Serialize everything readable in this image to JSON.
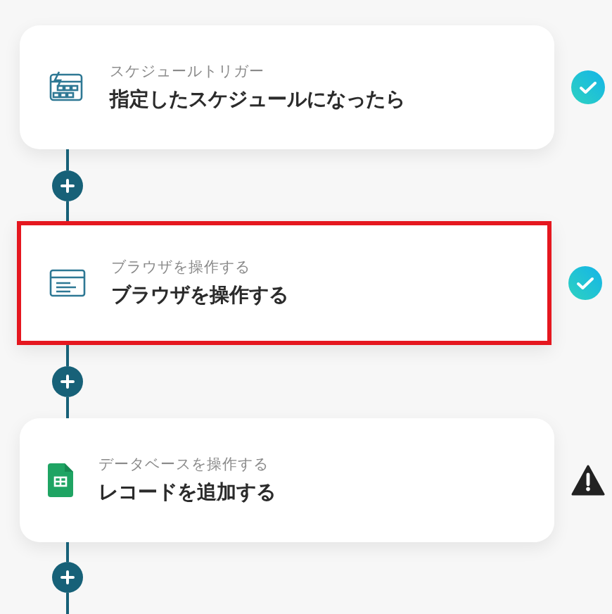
{
  "steps": [
    {
      "kind": "calendar",
      "category": "スケジュールトリガー",
      "title": "指定したスケジュールになったら",
      "done": true,
      "highlighted": false
    },
    {
      "kind": "browser",
      "category": "ブラウザを操作する",
      "title": "ブラウザを操作する",
      "done": true,
      "highlighted": true
    },
    {
      "kind": "sheet",
      "category": "データベースを操作する",
      "title": "レコードを追加する",
      "done": false,
      "highlighted": false
    }
  ]
}
